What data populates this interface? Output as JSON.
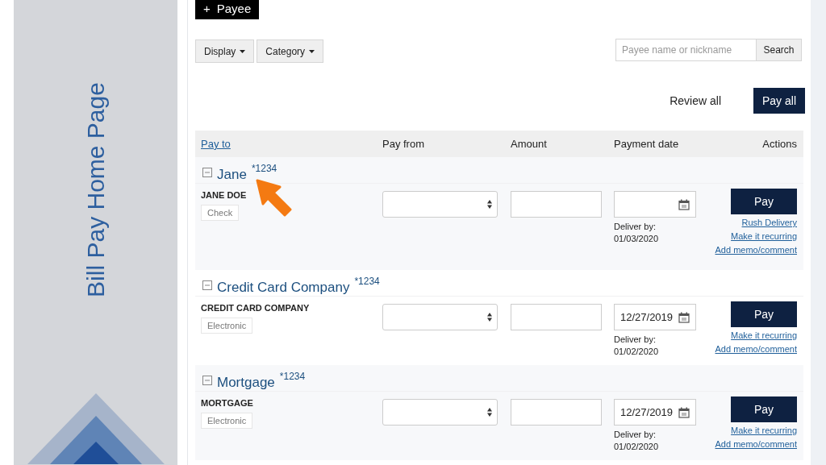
{
  "sidebar": {
    "title": "Bill Pay Home Page"
  },
  "add_payee_button": {
    "icon": "+",
    "label": "Payee"
  },
  "filters": [
    {
      "label": "Display"
    },
    {
      "label": "Category"
    }
  ],
  "search": {
    "placeholder": "Payee name or nickname",
    "button": "Search"
  },
  "review_all": "Review all",
  "pay_all": "Pay all",
  "table": {
    "columns": [
      {
        "label": "Pay to",
        "kind": "link"
      },
      {
        "label": "Pay from",
        "kind": "text"
      },
      {
        "label": "Amount",
        "kind": "text"
      },
      {
        "label": "Payment date",
        "kind": "text"
      },
      {
        "label": "Actions",
        "kind": "text"
      }
    ]
  },
  "payees": [
    {
      "name": "Jane",
      "account": "*1234",
      "full_name": "JANE DOE",
      "method": "Check",
      "deliver_label": "Deliver by:",
      "deliver_date": "01/03/2020",
      "pay": "Pay",
      "links": [
        "Rush Delivery",
        "Make it recurring",
        "Add memo/comment"
      ]
    },
    {
      "name": "Credit Card Company",
      "account": "*1234",
      "full_name": "CREDIT CARD COMPANY",
      "method": "Electronic",
      "date": "12/27/2019",
      "deliver_label": "Deliver by:",
      "deliver_date": "01/02/2020",
      "pay": "Pay",
      "links": [
        "Make it recurring",
        "Add memo/comment"
      ]
    },
    {
      "name": "Mortgage",
      "account": "*1234",
      "full_name": "MORTGAGE",
      "method": "Electronic",
      "date": "12/27/2019",
      "deliver_label": "Deliver by:",
      "deliver_date": "01/02/2020",
      "pay": "Pay",
      "links": [
        "Make it recurring",
        "Add memo/comment"
      ]
    }
  ]
}
